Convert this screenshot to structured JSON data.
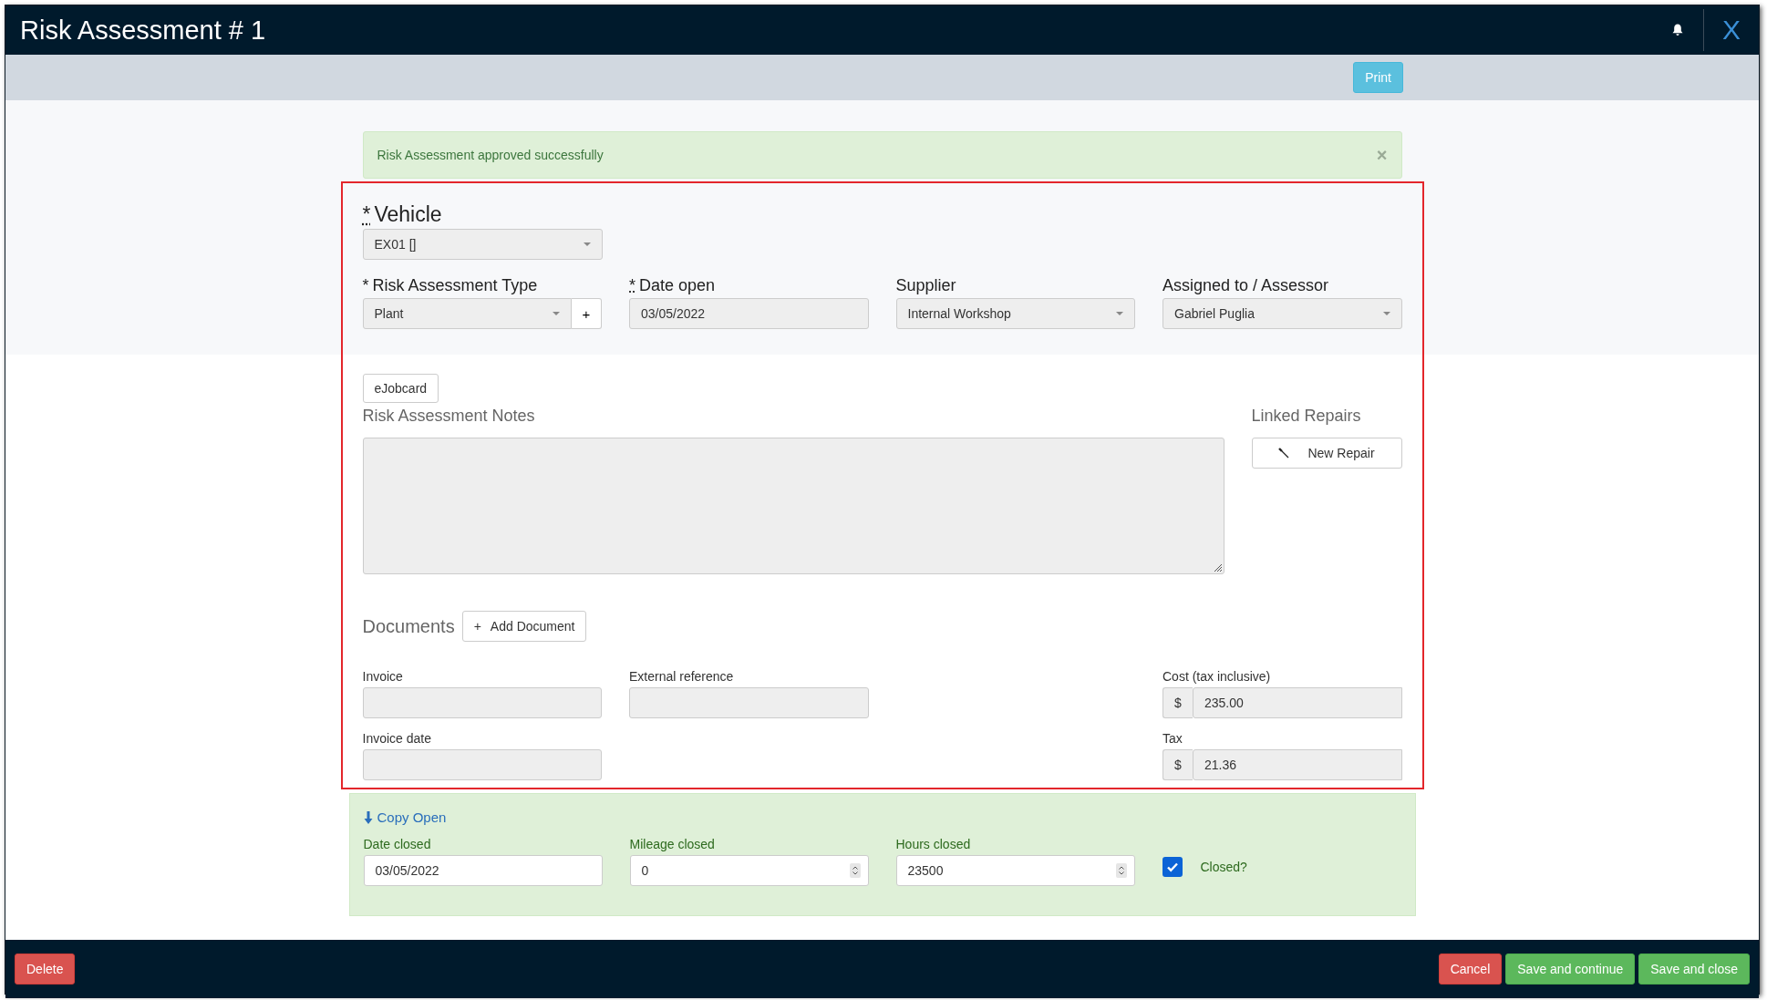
{
  "window": {
    "title": "Risk Assessment # 1",
    "close": "X"
  },
  "toolbar": {
    "buttons": [
      "Print"
    ]
  },
  "alert": {
    "message": "Risk Assessment approved successfully",
    "dismiss": "×"
  },
  "vehicle": {
    "kind": "select",
    "label": "Vehicle",
    "required": "*",
    "required_underlined": true,
    "value": "EX01 []",
    "disabled": true
  },
  "fields": [
    {
      "kind": "select_add",
      "label": "Risk Assessment Type",
      "required": "*",
      "required_underlined": false,
      "value": "Plant",
      "add": "+",
      "disabled": true
    },
    {
      "kind": "input",
      "label": "Date open",
      "required": "*",
      "required_underlined": true,
      "value": "03/05/2022",
      "disabled": true
    },
    {
      "kind": "select",
      "label": "Supplier",
      "value": "Internal Workshop",
      "disabled": true
    },
    {
      "kind": "select",
      "label": "Assigned to / Assessor",
      "value": "Gabriel Puglia",
      "disabled": true
    }
  ],
  "ejobcard_button": "eJobcard",
  "notes": {
    "label": "Risk Assessment Notes",
    "disabled": true
  },
  "linked_repairs": {
    "label": "Linked Repairs",
    "button": "New Repair"
  },
  "documents": {
    "label": "Documents",
    "button": "Add Document",
    "button_icon": "+"
  },
  "invoice_rows": [
    {
      "cells": [
        {
          "kind": "input",
          "label": "Invoice"
        },
        {
          "kind": "input",
          "label": "External reference"
        },
        {
          "kind": "empty"
        },
        {
          "kind": "money",
          "label": "Cost (tax inclusive)",
          "prefix": "$",
          "value": "235.00"
        }
      ]
    },
    {
      "cells": [
        {
          "kind": "input",
          "label": "Invoice date"
        },
        {
          "kind": "empty"
        },
        {
          "kind": "empty"
        },
        {
          "kind": "money",
          "label": "Tax",
          "prefix": "$",
          "value": "21.36"
        }
      ]
    }
  ],
  "closing": {
    "copy_link": "Copy Open",
    "fields": [
      {
        "kind": "date",
        "label": "Date closed",
        "value": "03/05/2022"
      },
      {
        "kind": "number",
        "label": "Mileage closed",
        "value": "0"
      },
      {
        "kind": "number",
        "label": "Hours closed",
        "value": "23500"
      }
    ],
    "closed": {
      "label": "Closed?",
      "checked": true
    }
  },
  "footer": {
    "left": [
      {
        "label": "Delete",
        "kind": "danger"
      }
    ],
    "right": [
      {
        "label": "Cancel",
        "kind": "danger"
      },
      {
        "label": "Save and continue",
        "kind": "success"
      },
      {
        "label": "Save and close",
        "kind": "success"
      }
    ]
  }
}
